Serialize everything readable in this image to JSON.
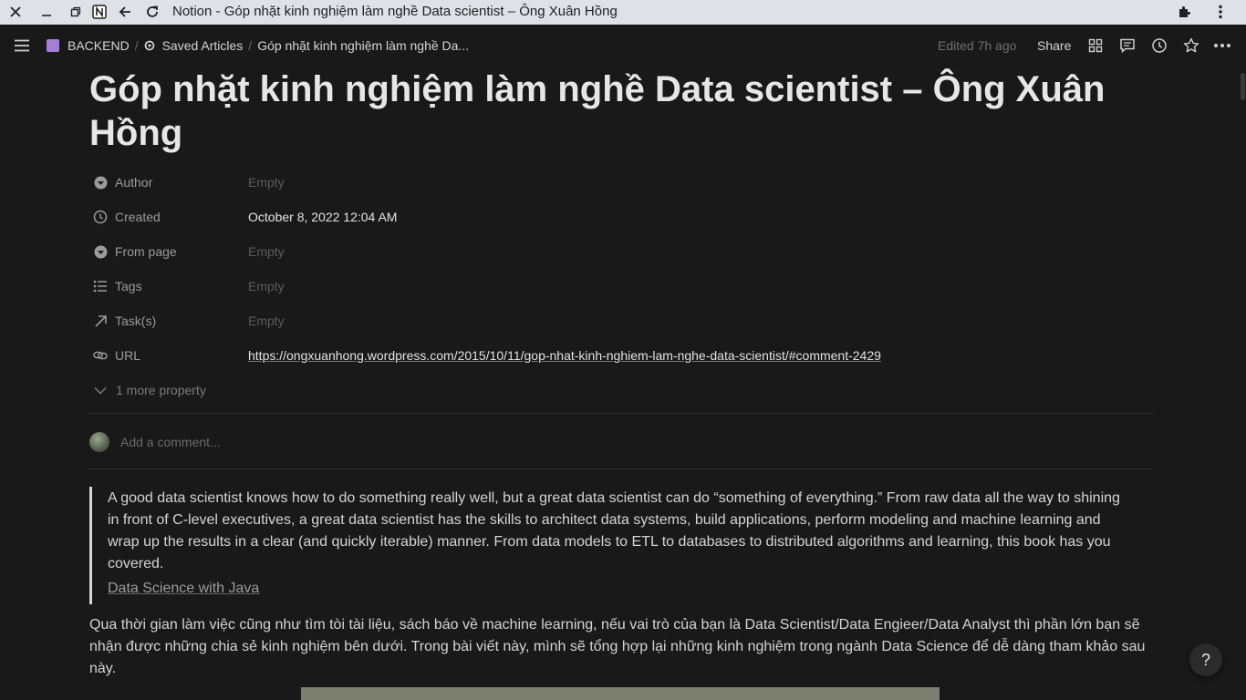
{
  "window": {
    "title": "Notion - Góp nhặt kinh nghiệm làm nghề Data scientist – Ông Xuân Hồng"
  },
  "breadcrumb": {
    "workspace": "BACKEND",
    "parent": "Saved Articles",
    "current": "Góp nhặt kinh nghiệm làm nghề Da..."
  },
  "topbar": {
    "edited": "Edited 7h ago",
    "share": "Share"
  },
  "page": {
    "title": "Góp nhặt kinh nghiệm làm nghề Data scientist – Ông Xuân Hồng",
    "properties": [
      {
        "name": "Author",
        "value": "Empty",
        "icon": "person-icon"
      },
      {
        "name": "Created",
        "value": "October 8, 2022 12:04 AM",
        "icon": "clock-icon"
      },
      {
        "name": "From page",
        "value": "Empty",
        "icon": "person-icon"
      },
      {
        "name": "Tags",
        "value": "Empty",
        "icon": "list-icon"
      },
      {
        "name": "Task(s)",
        "value": "Empty",
        "icon": "arrow-up-right-icon"
      },
      {
        "name": "URL",
        "value": "https://ongxuanhong.wordpress.com/2015/10/11/gop-nhat-kinh-nghiem-lam-nghe-data-scientist/#comment-2429",
        "icon": "link-icon"
      }
    ],
    "more_properties": "1 more property",
    "comment_placeholder": "Add a comment...",
    "quote": "A good data scientist knows how to do something really well, but a great data scientist can do “something of everything.” From raw data all the way to shining in front of C-level executives, a great data scientist has the skills to architect data systems, build applications, perform modeling and machine learning and wrap up the results in a clear (and quickly iterable) manner. From data models to ETL to databases to distributed algorithms and learning, this book has you covered.",
    "quote_link": "Data Science with Java",
    "paragraph": "Qua thời gian làm việc cũng như tìm tòi tài liệu, sách báo về machine learning, nếu vai trò của bạn là Data Scientist/Data Engieer/Data Analyst thì phần lớn bạn sẽ nhận được những chia sẻ kinh nghiệm bên dưới. Trong bài viết này, mình sẽ tổng hợp lại những kinh nghiệm trong ngành Data Science để dễ dàng tham khảo sau này."
  },
  "help": "?"
}
